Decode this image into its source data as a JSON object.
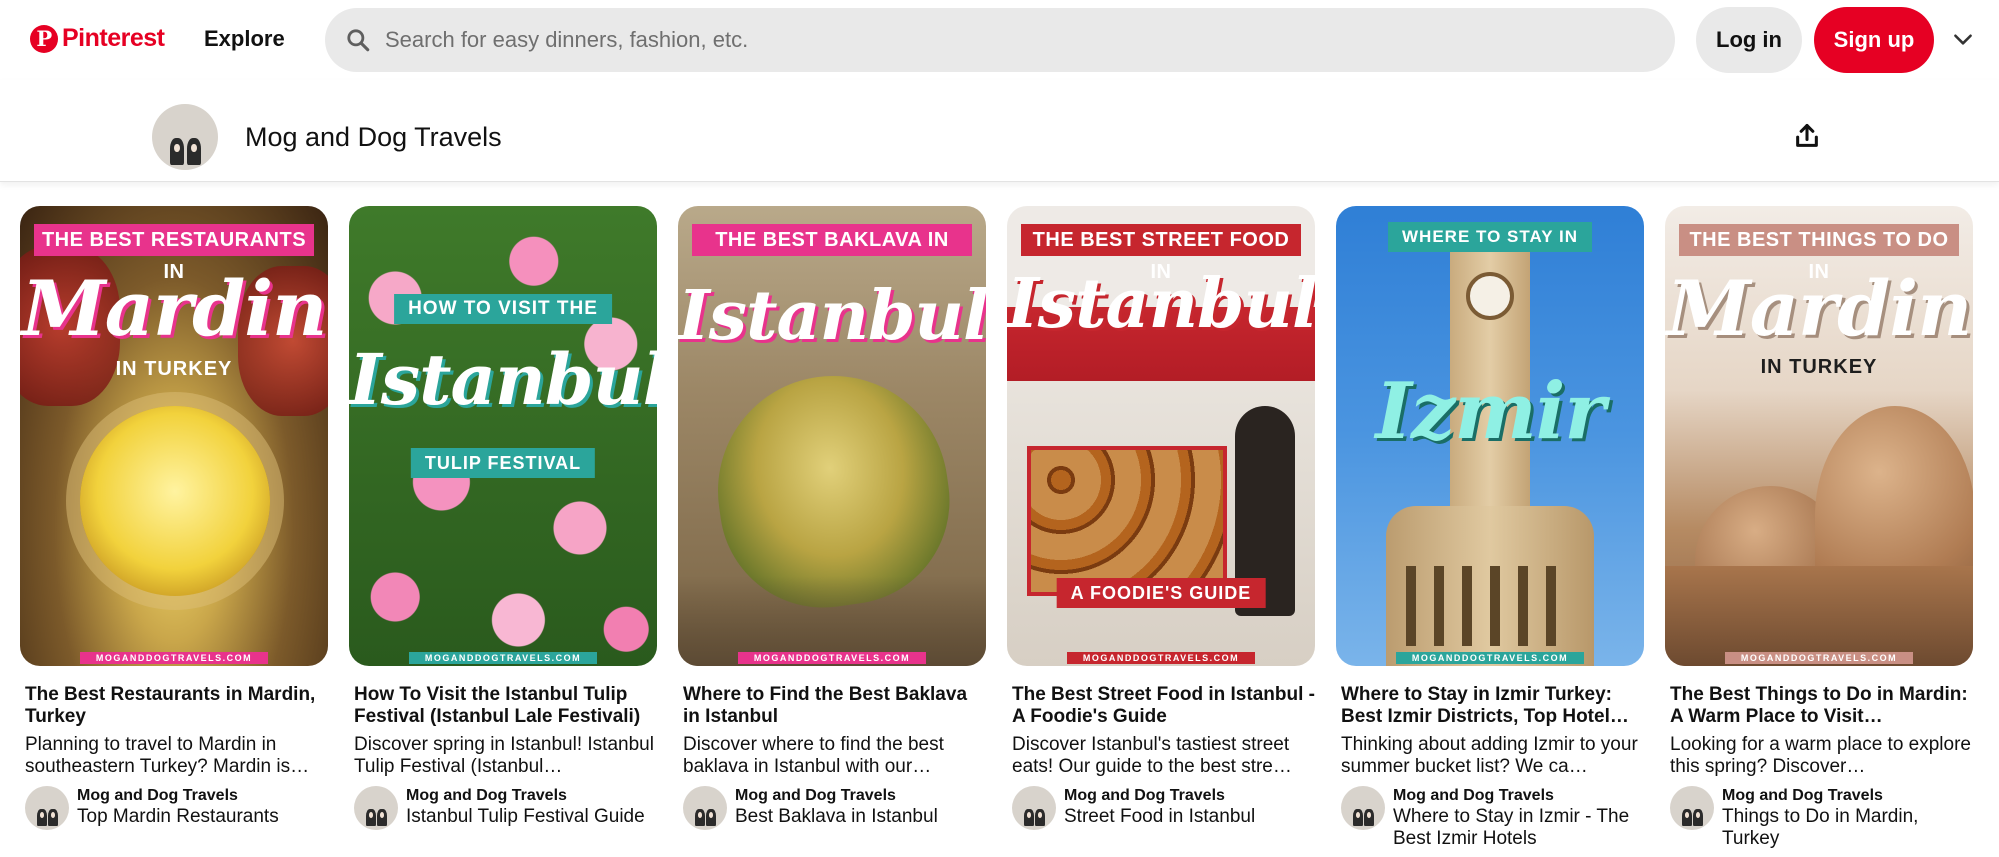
{
  "header": {
    "logo": "Pinterest",
    "explore": "Explore",
    "search_placeholder": "Search for easy dinners, fashion, etc.",
    "login": "Log in",
    "signup": "Sign up"
  },
  "profile": {
    "name": "Mog and Dog Travels"
  },
  "colors": {
    "brand_red": "#e60023",
    "pink": "#e8338c",
    "teal": "#2ba59b",
    "search_bg": "#e9e9e9"
  },
  "pins": [
    {
      "banner": "THE BEST RESTAURANTS IN",
      "script": "Mardin",
      "sub": "IN TURKEY",
      "url": "MOGANDDOGTRAVELS.COM",
      "title": "The Best Restaurants in Mardin, Turkey",
      "description": "Planning to travel to Mardin in southeastern Turkey? Mardin is…",
      "author": "Mog and Dog Travels",
      "board": "Top Mardin Restaurants"
    },
    {
      "banner": "HOW TO VISIT THE",
      "script": "Istanbul",
      "sub": "TULIP FESTIVAL",
      "url": "MOGANDDOGTRAVELS.COM",
      "title": "How To Visit the Istanbul Tulip Festival (Istanbul Lale Festivali)",
      "description": "Discover spring in Istanbul! Istanbul Tulip Festival (Istanbul…",
      "author": "Mog and Dog Travels",
      "board": "Istanbul Tulip Festival Guide"
    },
    {
      "banner": "THE BEST BAKLAVA IN",
      "script": "Istanbul",
      "sub": "",
      "url": "MOGANDDOGTRAVELS.COM",
      "title": "Where to Find the Best Baklava in Istanbul",
      "description": "Discover where to find the best baklava in Istanbul with our…",
      "author": "Mog and Dog Travels",
      "board": "Best Baklava in Istanbul"
    },
    {
      "banner": "THE BEST STREET FOOD IN",
      "script": "Istanbul",
      "sub": "A FOODIE'S GUIDE",
      "url": "MOGANDDOGTRAVELS.COM",
      "title": "The Best Street Food in Istanbul - A Foodie's Guide",
      "description": "Discover Istanbul's tastiest street eats! Our guide to the best stre…",
      "author": "Mog and Dog Travels",
      "board": "Street Food in Istanbul"
    },
    {
      "banner": "WHERE TO STAY IN",
      "script": "Izmir",
      "sub": "",
      "url": "MOGANDDOGTRAVELS.COM",
      "title": "Where to Stay in Izmir Turkey: Best Izmir Districts, Top Hotel…",
      "description": "Thinking about adding Izmir to your summer bucket list? We ca…",
      "author": "Mog and Dog Travels",
      "board": "Where to Stay in Izmir - The Best Izmir Hotels"
    },
    {
      "banner": "THE BEST THINGS TO DO IN",
      "script": "Mardin",
      "sub": "IN TURKEY",
      "url": "MOGANDDOGTRAVELS.COM",
      "title": "The Best Things to Do in Mardin: A Warm Place to Visit…",
      "description": "Looking for a warm place to explore this spring? Discover…",
      "author": "Mog and Dog Travels",
      "board": "Things to Do in Mardin, Turkey"
    }
  ]
}
